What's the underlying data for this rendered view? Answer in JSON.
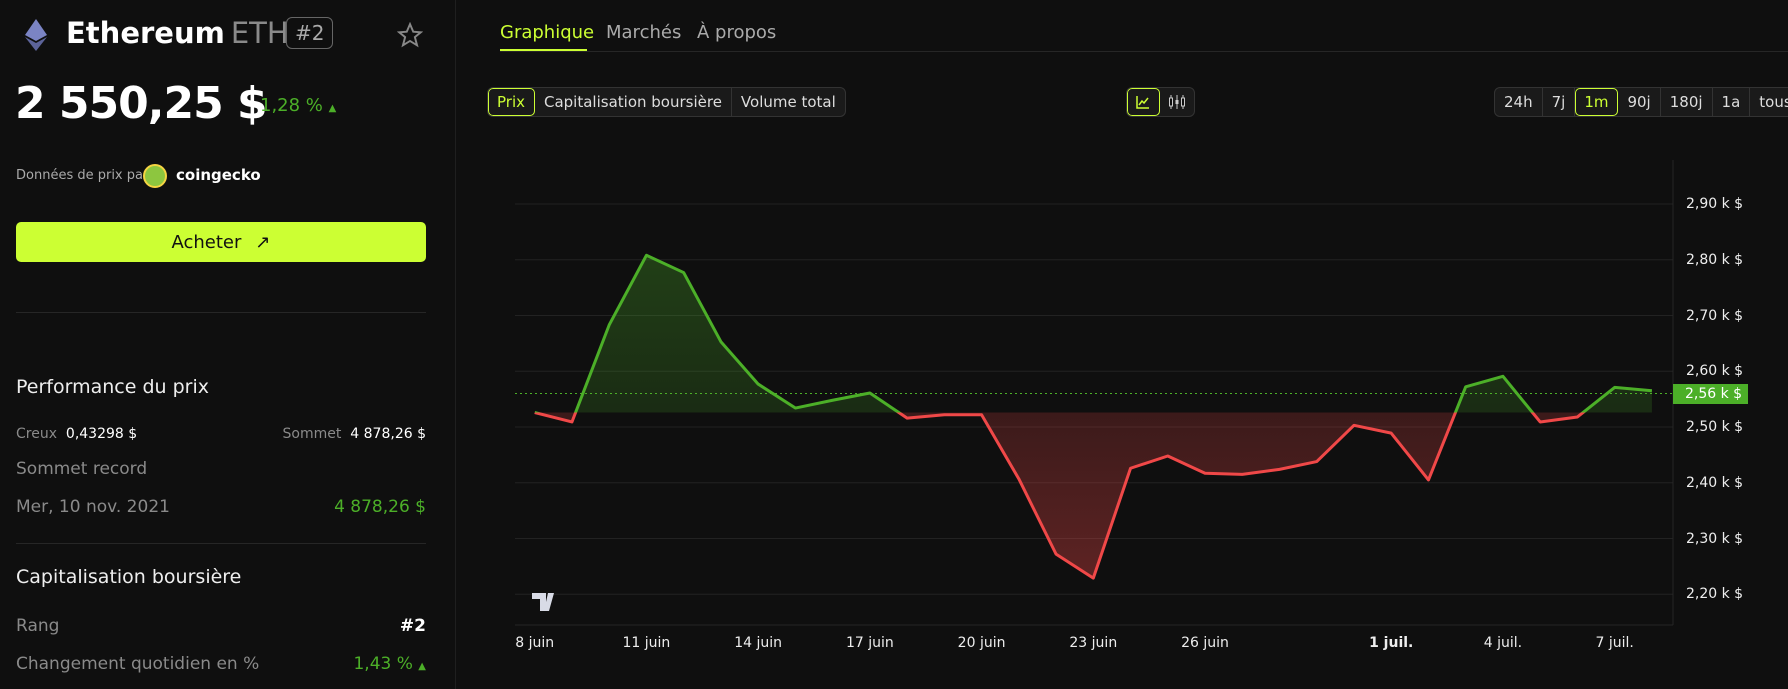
{
  "coin": {
    "name": "Ethereum",
    "symbol": "ETH",
    "rank_badge": "#2",
    "price": "2 550,25 $",
    "change": "1,28 %",
    "change_dir": "up"
  },
  "source": {
    "label": "Données de prix par",
    "provider": "coingecko"
  },
  "buy_button": "Acheter",
  "performance": {
    "title": "Performance du prix",
    "low_label": "Creux",
    "low_value": "0,43298 $",
    "high_label": "Sommet",
    "high_value": "4 878,26 $",
    "ath_label": "Sommet record",
    "ath_date": "Mer, 10 nov. 2021",
    "ath_value": "4 878,26 $"
  },
  "market_cap": {
    "title": "Capitalisation boursière",
    "rank_label": "Rang",
    "rank_value": "#2",
    "daily_change_label": "Changement quotidien en %",
    "daily_change_value": "1,43 %"
  },
  "tabs": [
    "Graphique",
    "Marchés",
    "À propos"
  ],
  "metric_buttons": [
    "Prix",
    "Capitalisation boursière",
    "Volume total"
  ],
  "chart_type_icons": [
    "line-chart-icon",
    "candlestick-icon"
  ],
  "range_buttons": [
    "24h",
    "7j",
    "1m",
    "90j",
    "180j",
    "1a",
    "tous"
  ],
  "selected": {
    "tab": 0,
    "metric": 0,
    "chart_type": 0,
    "range": 2
  },
  "colors": {
    "accent": "#ccff33",
    "up": "#4caf28",
    "down": "#f04848"
  },
  "chart_data": {
    "type": "line",
    "x": [
      "8 juin",
      "9 juin",
      "10 juin",
      "11 juin",
      "12 juin",
      "13 juin",
      "14 juin",
      "15 juin",
      "16 juin",
      "17 juin",
      "18 juin",
      "19 juin",
      "20 juin",
      "21 juin",
      "22 juin",
      "23 juin",
      "24 juin",
      "25 juin",
      "26 juin",
      "27 juin",
      "28 juin",
      "29 juin",
      "30 juin",
      "1 juil.",
      "2 juil.",
      "3 juil.",
      "4 juil.",
      "5 juil.",
      "6 juil.",
      "7 juil.",
      "8 juil."
    ],
    "values": [
      2526,
      2509,
      2683,
      2808,
      2777,
      2653,
      2577,
      2534,
      2548,
      2561,
      2516,
      2522,
      2522,
      2407,
      2272,
      2229,
      2426,
      2448,
      2417,
      2415,
      2424,
      2438,
      2503,
      2489,
      2405,
      2572,
      2591,
      2509,
      2518,
      2571,
      2565
    ],
    "baseline": 2526,
    "current_value": 2560,
    "current_label": "2,56 k $",
    "ylim": [
      2200,
      2900
    ],
    "yticks": [
      2900,
      2800,
      2700,
      2600,
      2500,
      2400,
      2300,
      2200
    ],
    "ytick_labels": [
      "2,90 k $",
      "2,80 k $",
      "2,70 k $",
      "2,60 k $",
      "2,50 k $",
      "2,40 k $",
      "2,30 k $",
      "2,20 k $"
    ],
    "xtick_labels": [
      {
        "i": 0,
        "label": "8 juin"
      },
      {
        "i": 3,
        "label": "11 juin"
      },
      {
        "i": 6,
        "label": "14 juin"
      },
      {
        "i": 9,
        "label": "17 juin"
      },
      {
        "i": 12,
        "label": "20 juin"
      },
      {
        "i": 15,
        "label": "23 juin"
      },
      {
        "i": 18,
        "label": "26 juin"
      },
      {
        "i": 23,
        "label": "1 juil."
      },
      {
        "i": 26,
        "label": "4 juil."
      },
      {
        "i": 29,
        "label": "7 juil."
      }
    ],
    "grid": true
  }
}
